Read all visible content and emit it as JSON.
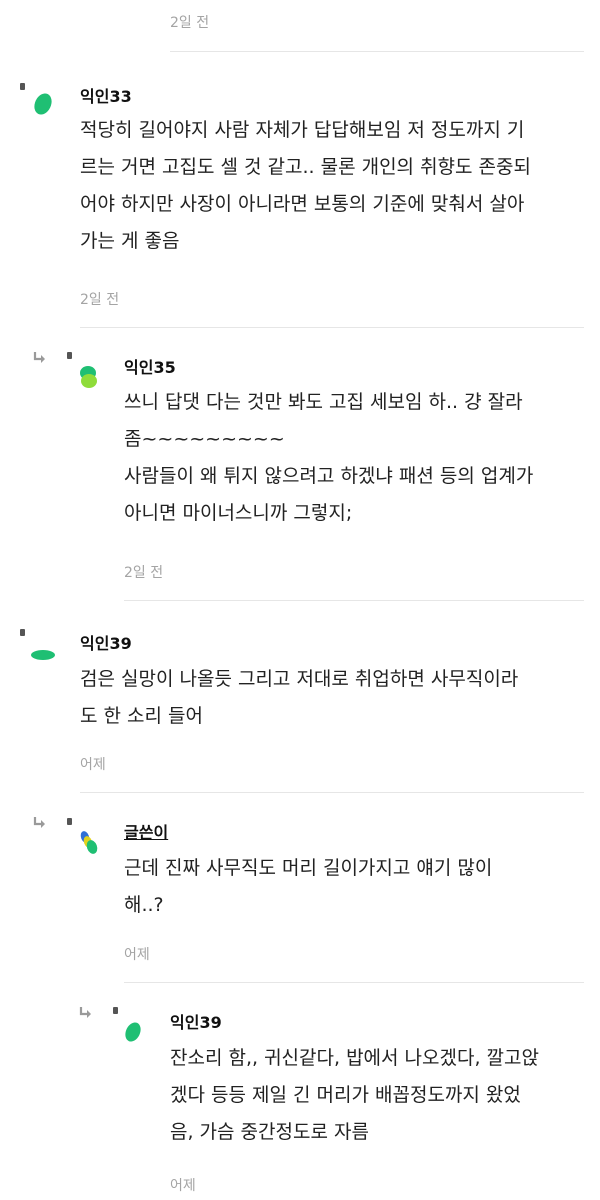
{
  "top": {
    "time": "2일 전"
  },
  "comments": [
    {
      "author": "익인33",
      "text": "적당히 길어야지 사람 자체가 답답해보임 저 정도까지 기\n르는 거면 고집도 셀 것 같고.. 물론 개인의 취향도 존중되\n어야 하지만 사장이 아니라면 보통의 기준에 맞춰서 살아\n가는 게 좋음",
      "time": "2일 전"
    },
    {
      "author": "익인35",
      "text": "쓰니 답댓 다는 것만 봐도 고집 세보임 하.. 걍 잘라\n좀~~~~~~~~~\n사람들이 왜 튀지 않으려고 하겠냐 패션 등의 업계가\n아니면 마이너스니까 그렇지;",
      "time": "2일 전"
    },
    {
      "author": "익인39",
      "text": "검은 실망이 나올듯 그리고 저대로 취업하면 사무직이라\n도 한 소리 들어",
      "time": "어제"
    },
    {
      "author": "글쓴이",
      "text": "근데 진짜 사무직도 머리 길이가지고 얘기 많이\n해..?",
      "time": "어제"
    },
    {
      "author": "익인39",
      "text": "잔소리 함,, 귀신같다, 밥에서 나오겠다, 깔고앉\n겠다 등등 제일 긴 머리가 배꼽정도까지 왔었\n음, 가슴 중간정도로 자름",
      "time": "어제"
    }
  ],
  "colors": {
    "accent_green": "#1fbf73",
    "light_green": "#8fdc3a",
    "blue": "#2f6fd6",
    "yellow": "#e0d21e"
  }
}
